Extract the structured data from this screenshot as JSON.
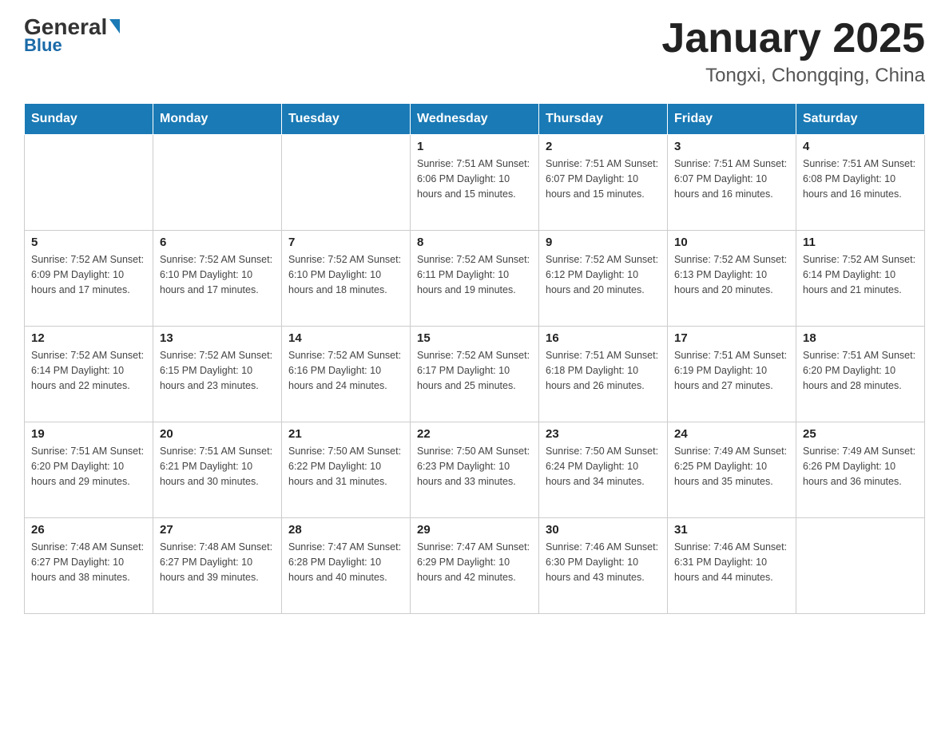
{
  "header": {
    "logo_general": "General",
    "logo_blue": "Blue",
    "title": "January 2025",
    "subtitle": "Tongxi, Chongqing, China"
  },
  "days_of_week": [
    "Sunday",
    "Monday",
    "Tuesday",
    "Wednesday",
    "Thursday",
    "Friday",
    "Saturday"
  ],
  "weeks": [
    [
      {
        "day": "",
        "info": ""
      },
      {
        "day": "",
        "info": ""
      },
      {
        "day": "",
        "info": ""
      },
      {
        "day": "1",
        "info": "Sunrise: 7:51 AM\nSunset: 6:06 PM\nDaylight: 10 hours\nand 15 minutes."
      },
      {
        "day": "2",
        "info": "Sunrise: 7:51 AM\nSunset: 6:07 PM\nDaylight: 10 hours\nand 15 minutes."
      },
      {
        "day": "3",
        "info": "Sunrise: 7:51 AM\nSunset: 6:07 PM\nDaylight: 10 hours\nand 16 minutes."
      },
      {
        "day": "4",
        "info": "Sunrise: 7:51 AM\nSunset: 6:08 PM\nDaylight: 10 hours\nand 16 minutes."
      }
    ],
    [
      {
        "day": "5",
        "info": "Sunrise: 7:52 AM\nSunset: 6:09 PM\nDaylight: 10 hours\nand 17 minutes."
      },
      {
        "day": "6",
        "info": "Sunrise: 7:52 AM\nSunset: 6:10 PM\nDaylight: 10 hours\nand 17 minutes."
      },
      {
        "day": "7",
        "info": "Sunrise: 7:52 AM\nSunset: 6:10 PM\nDaylight: 10 hours\nand 18 minutes."
      },
      {
        "day": "8",
        "info": "Sunrise: 7:52 AM\nSunset: 6:11 PM\nDaylight: 10 hours\nand 19 minutes."
      },
      {
        "day": "9",
        "info": "Sunrise: 7:52 AM\nSunset: 6:12 PM\nDaylight: 10 hours\nand 20 minutes."
      },
      {
        "day": "10",
        "info": "Sunrise: 7:52 AM\nSunset: 6:13 PM\nDaylight: 10 hours\nand 20 minutes."
      },
      {
        "day": "11",
        "info": "Sunrise: 7:52 AM\nSunset: 6:14 PM\nDaylight: 10 hours\nand 21 minutes."
      }
    ],
    [
      {
        "day": "12",
        "info": "Sunrise: 7:52 AM\nSunset: 6:14 PM\nDaylight: 10 hours\nand 22 minutes."
      },
      {
        "day": "13",
        "info": "Sunrise: 7:52 AM\nSunset: 6:15 PM\nDaylight: 10 hours\nand 23 minutes."
      },
      {
        "day": "14",
        "info": "Sunrise: 7:52 AM\nSunset: 6:16 PM\nDaylight: 10 hours\nand 24 minutes."
      },
      {
        "day": "15",
        "info": "Sunrise: 7:52 AM\nSunset: 6:17 PM\nDaylight: 10 hours\nand 25 minutes."
      },
      {
        "day": "16",
        "info": "Sunrise: 7:51 AM\nSunset: 6:18 PM\nDaylight: 10 hours\nand 26 minutes."
      },
      {
        "day": "17",
        "info": "Sunrise: 7:51 AM\nSunset: 6:19 PM\nDaylight: 10 hours\nand 27 minutes."
      },
      {
        "day": "18",
        "info": "Sunrise: 7:51 AM\nSunset: 6:20 PM\nDaylight: 10 hours\nand 28 minutes."
      }
    ],
    [
      {
        "day": "19",
        "info": "Sunrise: 7:51 AM\nSunset: 6:20 PM\nDaylight: 10 hours\nand 29 minutes."
      },
      {
        "day": "20",
        "info": "Sunrise: 7:51 AM\nSunset: 6:21 PM\nDaylight: 10 hours\nand 30 minutes."
      },
      {
        "day": "21",
        "info": "Sunrise: 7:50 AM\nSunset: 6:22 PM\nDaylight: 10 hours\nand 31 minutes."
      },
      {
        "day": "22",
        "info": "Sunrise: 7:50 AM\nSunset: 6:23 PM\nDaylight: 10 hours\nand 33 minutes."
      },
      {
        "day": "23",
        "info": "Sunrise: 7:50 AM\nSunset: 6:24 PM\nDaylight: 10 hours\nand 34 minutes."
      },
      {
        "day": "24",
        "info": "Sunrise: 7:49 AM\nSunset: 6:25 PM\nDaylight: 10 hours\nand 35 minutes."
      },
      {
        "day": "25",
        "info": "Sunrise: 7:49 AM\nSunset: 6:26 PM\nDaylight: 10 hours\nand 36 minutes."
      }
    ],
    [
      {
        "day": "26",
        "info": "Sunrise: 7:48 AM\nSunset: 6:27 PM\nDaylight: 10 hours\nand 38 minutes."
      },
      {
        "day": "27",
        "info": "Sunrise: 7:48 AM\nSunset: 6:27 PM\nDaylight: 10 hours\nand 39 minutes."
      },
      {
        "day": "28",
        "info": "Sunrise: 7:47 AM\nSunset: 6:28 PM\nDaylight: 10 hours\nand 40 minutes."
      },
      {
        "day": "29",
        "info": "Sunrise: 7:47 AM\nSunset: 6:29 PM\nDaylight: 10 hours\nand 42 minutes."
      },
      {
        "day": "30",
        "info": "Sunrise: 7:46 AM\nSunset: 6:30 PM\nDaylight: 10 hours\nand 43 minutes."
      },
      {
        "day": "31",
        "info": "Sunrise: 7:46 AM\nSunset: 6:31 PM\nDaylight: 10 hours\nand 44 minutes."
      },
      {
        "day": "",
        "info": ""
      }
    ]
  ]
}
